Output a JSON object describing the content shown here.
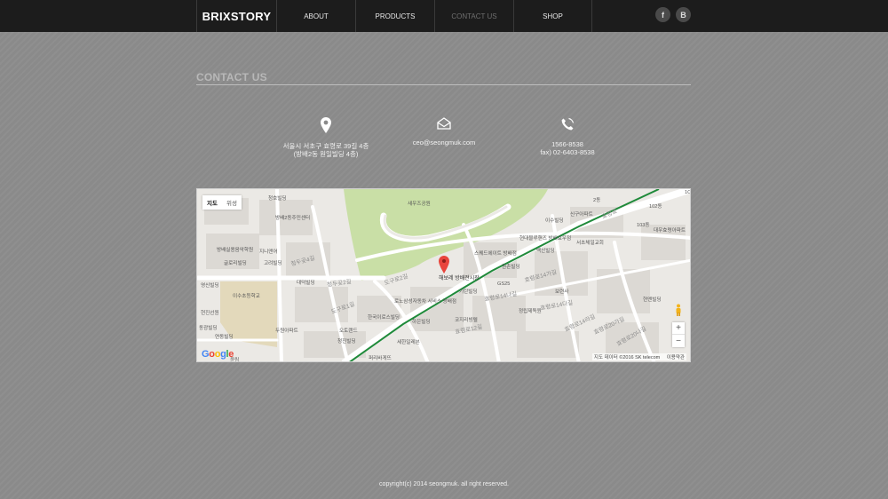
{
  "header": {
    "brand": "BRIXSTORY",
    "menu": [
      "ABOUT",
      "PRODUCTS",
      "CONTACT US",
      "SHOP"
    ],
    "active_menu": "CONTACT US",
    "social": [
      "f",
      "B"
    ]
  },
  "section": {
    "title": "CONTACT US"
  },
  "contacts": {
    "address": {
      "line1": "서울시 서초구 효령로 39길 4층",
      "line2": "(방배2동 원일빌딩 4층)"
    },
    "email": {
      "line1": "ceo@seongmuk.com"
    },
    "phone": {
      "line1": "1566-8538",
      "line2": "fax) 02-6403-8538"
    }
  },
  "map": {
    "tabs": [
      "지도",
      "위성"
    ],
    "active_tab": "지도",
    "zoom_in": "+",
    "zoom_out": "−",
    "logo": "Google",
    "attribution": "지도 데이터 ©2016 SK telecom",
    "terms": "이용약관",
    "place_label": "해보레 방배전시장",
    "pois": [
      "청호빌딩",
      "방배2동주민센터",
      "방배실용음악학원",
      "지니앤어",
      "글로리빌딩",
      "고려빌딩",
      "영신빌딩",
      "이수초등학교",
      "현진선원",
      "동광빌딩",
      "연동빌딩",
      "대덕빌딩",
      "두원아파트",
      "오토랜드",
      "청진빌딩",
      "한국이로스빌딩",
      "로노삼성자동차 서비스 방배점",
      "하은빌딩",
      "세한일레븐",
      "퍼리바게뜨",
      "기탄빌딩",
      "코지리빙텔",
      "스퀘드에이트 방배점",
      "원촌빌딩",
      "GS25",
      "현대블루핸즈 방배효우점",
      "백산빌딩",
      "보련사",
      "정립제독원",
      "서초체일교회",
      "신구아파트",
      "대우효령아파트",
      "현엔빌딩",
      "이수빌딩",
      "새우즈공원",
      "103동",
      "102동",
      "2동",
      "1C",
      "윤링",
      "효령로",
      "청두곶4길",
      "청두곶2길",
      "도구로1길",
      "도구로2길",
      "효령로12길",
      "효령로14나길",
      "효령로14가길",
      "효령로14다길",
      "효령로14라길",
      "효령로20가길",
      "효령로20나길",
      "효령로20다길",
      "효령로18길",
      "효령로14라길",
      "도구로6길",
      "효령로7길",
      "청두곶6길",
      "청두곶길",
      "도구로8길",
      "효령로12길",
      "효령로14다길",
      "효령로20다길",
      "효령로24길",
      "효령로20길",
      "도구로3길",
      "효령로14다",
      "효령로8길",
      "효령로4길"
    ]
  },
  "footer": {
    "copyright": "copyright(c) 2014 seongmuk. all right reserved."
  },
  "colors": {
    "header_bg": "#1c1c1c",
    "page_bg": "#8a8a8a",
    "subway_line": "#1f8a3a",
    "park": "#c9dfa6",
    "school": "#e3d9bb",
    "pin": "#e8453c"
  }
}
